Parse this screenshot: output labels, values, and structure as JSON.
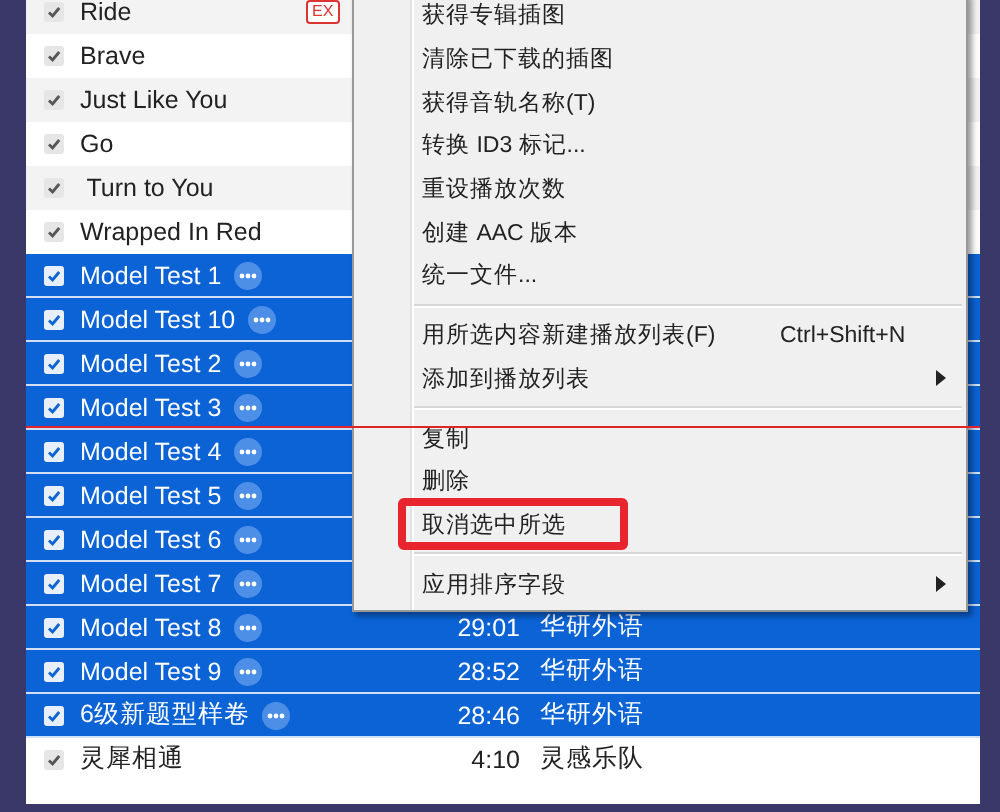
{
  "tracks": [
    {
      "name": "Ride",
      "checked": true,
      "selected": false,
      "badge": "EX"
    },
    {
      "name": "Brave",
      "checked": true,
      "selected": false
    },
    {
      "name": "Just Like You",
      "checked": true,
      "selected": false
    },
    {
      "name": "Go",
      "checked": true,
      "selected": false
    },
    {
      "name": " Turn to You",
      "checked": true,
      "selected": false
    },
    {
      "name": "Wrapped In Red",
      "checked": true,
      "selected": false
    },
    {
      "name": "Model Test 1",
      "checked": true,
      "selected": true
    },
    {
      "name": "Model Test 10",
      "checked": true,
      "selected": true
    },
    {
      "name": "Model Test 2",
      "checked": true,
      "selected": true
    },
    {
      "name": "Model Test 3",
      "checked": true,
      "selected": true,
      "red_line": true
    },
    {
      "name": "Model Test 4",
      "checked": true,
      "selected": true
    },
    {
      "name": "Model Test 5",
      "checked": true,
      "selected": true
    },
    {
      "name": "Model Test 6",
      "checked": true,
      "selected": true
    },
    {
      "name": "Model Test 7",
      "checked": true,
      "selected": true
    },
    {
      "name": "Model Test 8",
      "checked": true,
      "selected": true,
      "time": "29:01",
      "artist": "华研外语"
    },
    {
      "name": "Model Test 9",
      "checked": true,
      "selected": true,
      "time": "28:52",
      "artist": "华研外语"
    },
    {
      "name": "6级新题型样卷",
      "checked": true,
      "selected": true,
      "time": "28:46",
      "artist": "华研外语"
    },
    {
      "name": "灵犀相通",
      "checked": true,
      "selected": false,
      "time": "4:10",
      "artist": "灵感乐队"
    }
  ],
  "context_menu": [
    {
      "kind": "item",
      "label": "获得专辑插图"
    },
    {
      "kind": "item",
      "label": "清除已下载的插图"
    },
    {
      "kind": "item",
      "label": "获得音轨名称(T)"
    },
    {
      "kind": "item",
      "label": "转换 ID3 标记..."
    },
    {
      "kind": "item",
      "label": "重设播放次数"
    },
    {
      "kind": "item",
      "label": "创建 AAC 版本"
    },
    {
      "kind": "item",
      "label": "统一文件..."
    },
    {
      "kind": "separator"
    },
    {
      "kind": "item",
      "label": "用所选内容新建播放列表(F)",
      "shortcut": "Ctrl+Shift+N"
    },
    {
      "kind": "item",
      "label": "添加到播放列表",
      "submenu": true
    },
    {
      "kind": "separator"
    },
    {
      "kind": "item",
      "label": "复制"
    },
    {
      "kind": "item",
      "label": "删除"
    },
    {
      "kind": "item",
      "label": "取消选中所选",
      "marked": true
    },
    {
      "kind": "separator"
    },
    {
      "kind": "item",
      "label": "应用排序字段",
      "submenu": true
    }
  ]
}
